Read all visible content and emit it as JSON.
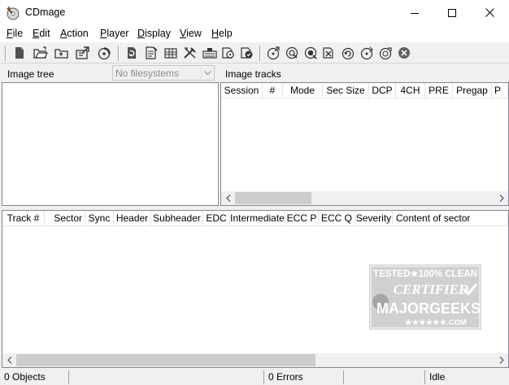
{
  "window": {
    "title": "CDmage",
    "controls": [
      "minimize",
      "maximize",
      "close"
    ]
  },
  "menu": [
    {
      "label": "File",
      "mnemonic": "F",
      "rest": "ile"
    },
    {
      "label": "Edit",
      "mnemonic": "E",
      "rest": "dit"
    },
    {
      "label": "Action",
      "mnemonic": "A",
      "rest": "ction"
    },
    {
      "label": "Player",
      "mnemonic": "P",
      "rest": "layer"
    },
    {
      "label": "Display",
      "mnemonic": "D",
      "rest": "isplay"
    },
    {
      "label": "View",
      "mnemonic": "V",
      "rest": "iew"
    },
    {
      "label": "Help",
      "mnemonic": "H",
      "rest": "elp"
    }
  ],
  "toolbar": {
    "icons": [
      "new-file-icon",
      "open-folder-icon",
      "folder-up-icon",
      "properties-icon",
      "disc-browse-icon",
      "convert-icon",
      "save-track-icon",
      "extract-icon",
      "tools-icon",
      "image-info-icon",
      "scan-icon",
      "check-icon",
      "play-icon",
      "search-disc-icon",
      "zoom-disc-icon",
      "disc-report-icon",
      "refresh-disc-icon",
      "next-disc-icon",
      "test-disc-icon",
      "stop-icon"
    ]
  },
  "image_tree": {
    "label": "Image tree",
    "filesystem_select": "No filesystems"
  },
  "image_tracks": {
    "label": "Image tracks",
    "columns": [
      "Session",
      "#",
      "Mode",
      "Sec Size",
      "DCP",
      "4CH",
      "PRE",
      "Pregap",
      "P"
    ]
  },
  "sectors": {
    "columns": [
      "Track #",
      "Sector",
      "Sync",
      "Header",
      "Subheader",
      "EDC",
      "Intermediate",
      "ECC P",
      "ECC Q",
      "Severity",
      "Content of sector"
    ]
  },
  "watermark": {
    "line1": "TESTED★100% CLEAN",
    "line2": "CERTIFIED",
    "line3": "MAJORGEEKS",
    "line4": "★★★★★★.COM"
  },
  "status": {
    "objects": "0 Objects",
    "errors": "0 Errors",
    "state": "Idle"
  },
  "colors": {
    "window_bg": "#f0f0f0",
    "pane_bg": "#ffffff",
    "scroll_thumb": "#cdcdcd",
    "accent_blue": "#2f6fb5",
    "stop_gray": "#606060"
  }
}
